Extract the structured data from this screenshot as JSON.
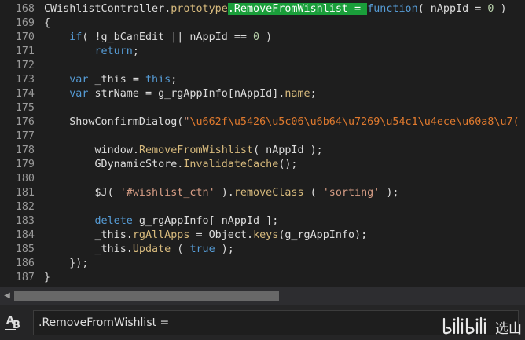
{
  "editor": {
    "lines": [
      {
        "number": "168",
        "tokens": [
          {
            "t": "CWishlistController",
            "c": "ident"
          },
          {
            "t": ".",
            "c": "plain"
          },
          {
            "t": "prototype",
            "c": "prop"
          },
          {
            "t": ".RemoveFromWishlist = ",
            "c": "match"
          },
          {
            "t": "function",
            "c": "kw"
          },
          {
            "t": "( nAppId = ",
            "c": "plain"
          },
          {
            "t": "0",
            "c": "num"
          },
          {
            "t": " )",
            "c": "plain"
          }
        ]
      },
      {
        "number": "169",
        "tokens": [
          {
            "t": "{",
            "c": "plain"
          }
        ]
      },
      {
        "number": "170",
        "tokens": [
          {
            "t": "    ",
            "c": "plain"
          },
          {
            "t": "if",
            "c": "kw"
          },
          {
            "t": "( !g_bCanEdit || nAppId == ",
            "c": "plain"
          },
          {
            "t": "0",
            "c": "num"
          },
          {
            "t": " )",
            "c": "plain"
          }
        ]
      },
      {
        "number": "171",
        "tokens": [
          {
            "t": "        ",
            "c": "plain"
          },
          {
            "t": "return",
            "c": "kw"
          },
          {
            "t": ";",
            "c": "plain"
          }
        ]
      },
      {
        "number": "172",
        "tokens": []
      },
      {
        "number": "173",
        "tokens": [
          {
            "t": "    ",
            "c": "plain"
          },
          {
            "t": "var",
            "c": "kw"
          },
          {
            "t": " _this = ",
            "c": "plain"
          },
          {
            "t": "this",
            "c": "kw"
          },
          {
            "t": ";",
            "c": "plain"
          }
        ]
      },
      {
        "number": "174",
        "tokens": [
          {
            "t": "    ",
            "c": "plain"
          },
          {
            "t": "var",
            "c": "kw"
          },
          {
            "t": " strName = g_rgAppInfo[nAppId].",
            "c": "plain"
          },
          {
            "t": "name",
            "c": "prop"
          },
          {
            "t": ";",
            "c": "plain"
          }
        ]
      },
      {
        "number": "175",
        "tokens": []
      },
      {
        "number": "176",
        "tokens": [
          {
            "t": "    ShowConfirmDialog(",
            "c": "plain"
          },
          {
            "t": "\"",
            "c": "str"
          },
          {
            "t": "\\u662f\\u5426\\u5c06\\u6b64\\u7269\\u54c1\\u4ece\\u60a8\\u7(",
            "c": "esc"
          }
        ]
      },
      {
        "number": "177",
        "tokens": []
      },
      {
        "number": "178",
        "tokens": [
          {
            "t": "        window.",
            "c": "plain"
          },
          {
            "t": "RemoveFromWishlist",
            "c": "prop"
          },
          {
            "t": "( nAppId );",
            "c": "plain"
          }
        ]
      },
      {
        "number": "179",
        "tokens": [
          {
            "t": "        GDynamicStore.",
            "c": "plain"
          },
          {
            "t": "InvalidateCache",
            "c": "prop"
          },
          {
            "t": "();",
            "c": "plain"
          }
        ]
      },
      {
        "number": "180",
        "tokens": []
      },
      {
        "number": "181",
        "tokens": [
          {
            "t": "        $J( ",
            "c": "plain"
          },
          {
            "t": "'#wishlist_ctn'",
            "c": "str"
          },
          {
            "t": " ).",
            "c": "plain"
          },
          {
            "t": "removeClass",
            "c": "prop"
          },
          {
            "t": " ( ",
            "c": "plain"
          },
          {
            "t": "'sorting'",
            "c": "str"
          },
          {
            "t": " );",
            "c": "plain"
          }
        ]
      },
      {
        "number": "182",
        "tokens": []
      },
      {
        "number": "183",
        "tokens": [
          {
            "t": "        ",
            "c": "plain"
          },
          {
            "t": "delete",
            "c": "kw"
          },
          {
            "t": " g_rgAppInfo[ nAppId ];",
            "c": "plain"
          }
        ]
      },
      {
        "number": "184",
        "tokens": [
          {
            "t": "        _this.",
            "c": "plain"
          },
          {
            "t": "rgAllApps",
            "c": "prop"
          },
          {
            "t": " = Object.",
            "c": "plain"
          },
          {
            "t": "keys",
            "c": "prop"
          },
          {
            "t": "(g_rgAppInfo);",
            "c": "plain"
          }
        ]
      },
      {
        "number": "185",
        "tokens": [
          {
            "t": "        _this.",
            "c": "plain"
          },
          {
            "t": "Update",
            "c": "prop"
          },
          {
            "t": " ( ",
            "c": "plain"
          },
          {
            "t": "true",
            "c": "kw"
          },
          {
            "t": " );",
            "c": "plain"
          }
        ]
      },
      {
        "number": "186",
        "tokens": [
          {
            "t": "    });",
            "c": "plain"
          }
        ]
      },
      {
        "number": "187",
        "tokens": [
          {
            "t": "}",
            "c": "plain"
          }
        ]
      }
    ]
  },
  "scrollbar": {
    "left_arrow": "◀"
  },
  "find": {
    "case_icon": "match-case-icon",
    "case_label_a": "A",
    "case_label_b": "B",
    "query": ".RemoveFromWishlist ="
  },
  "watermark": {
    "text": "选山"
  },
  "colors": {
    "background": "#1e1e1e",
    "match_highlight": "#1a9e3a",
    "keyword": "#569cd6",
    "string": "#d69d85",
    "property": "#d7ba7d"
  }
}
